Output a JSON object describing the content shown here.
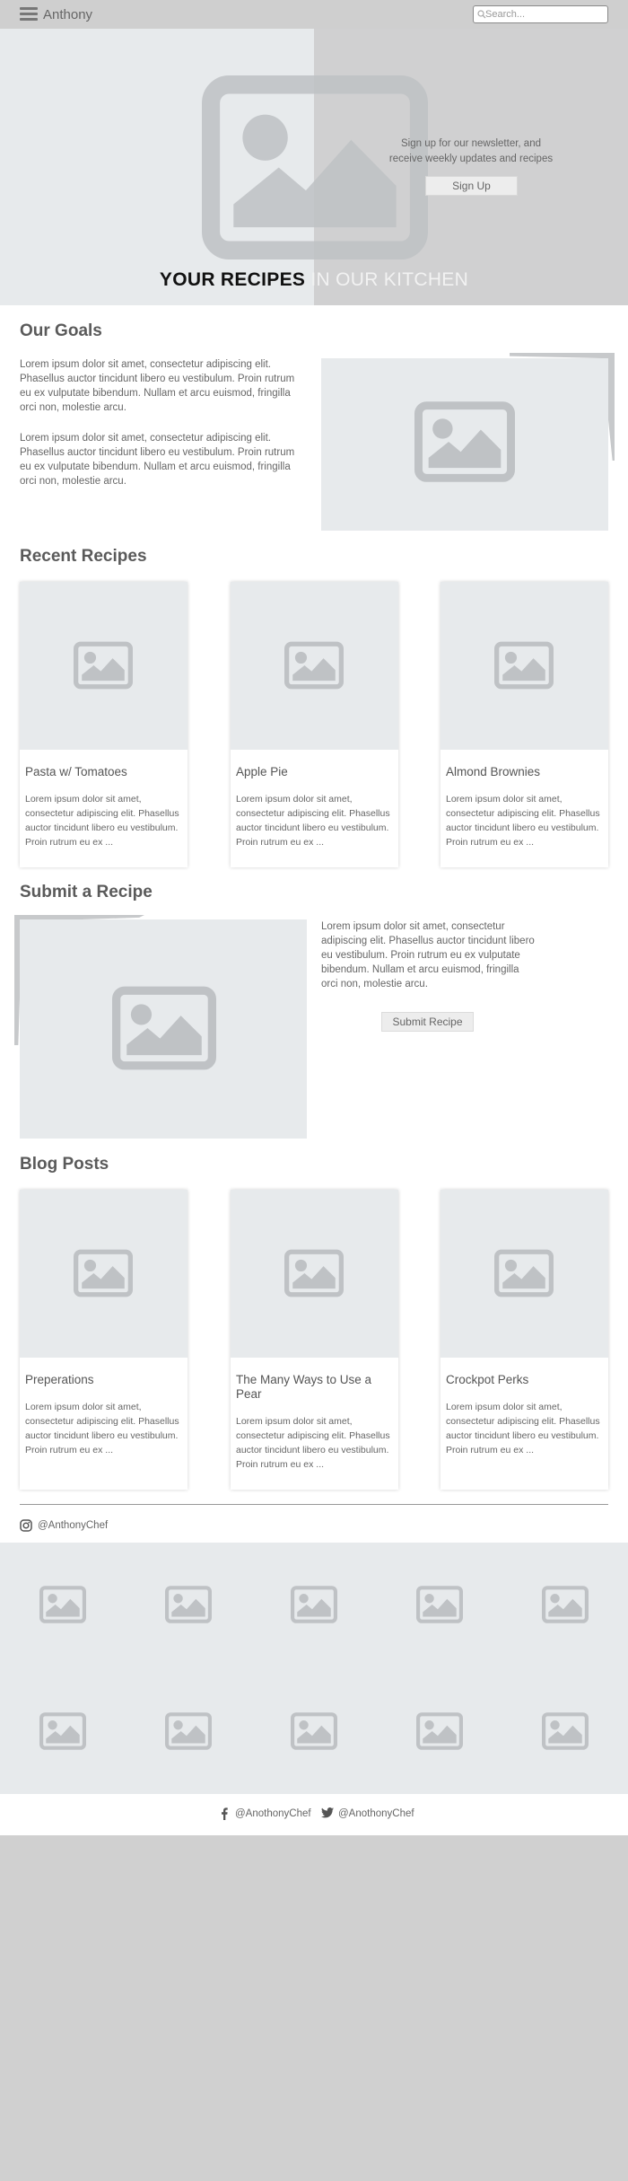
{
  "header": {
    "brand": "Anthony",
    "search_placeholder": "Search...",
    "icons": [
      "hamburger-menu-icon",
      "search-icon"
    ]
  },
  "hero": {
    "newsletter_text": "Sign up for our newsletter, and receive weekly updates and recipes",
    "signup_label": "Sign Up",
    "title_part1": "YOUR RECIPES",
    "title_part2": "IN OUR KITCHEN"
  },
  "goals": {
    "heading": "Our Goals",
    "paragraph1": "Lorem ipsum dolor sit amet, consectetur adipiscing elit. Phasellus auctor tincidunt libero eu vestibulum. Proin rutrum eu ex vulputate bibendum. Nullam et arcu euismod, fringilla orci non, molestie arcu.",
    "paragraph2": "Lorem ipsum dolor sit amet, consectetur adipiscing elit. Phasellus auctor tincidunt libero eu vestibulum. Proin rutrum eu ex vulputate bibendum. Nullam et arcu euismod, fringilla orci non, molestie arcu."
  },
  "recent": {
    "heading": "Recent Recipes",
    "cards": [
      {
        "title": "Pasta w/ Tomatoes",
        "text": "Lorem ipsum dolor sit amet, consectetur adipiscing elit. Phasellus auctor tincidunt libero eu vestibulum. Proin rutrum eu ex ..."
      },
      {
        "title": "Apple Pie",
        "text": "Lorem ipsum dolor sit amet, consectetur adipiscing elit. Phasellus auctor tincidunt libero eu vestibulum. Proin rutrum eu ex ..."
      },
      {
        "title": "Almond Brownies",
        "text": "Lorem ipsum dolor sit amet, consectetur adipiscing elit. Phasellus auctor tincidunt libero eu vestibulum. Proin rutrum eu ex ..."
      }
    ]
  },
  "submit": {
    "heading": "Submit a Recipe",
    "text": "Lorem ipsum dolor sit amet, consectetur adipiscing elit. Phasellus auctor tincidunt libero eu vestibulum. Proin rutrum eu ex vulputate bibendum. Nullam et arcu euismod, fringilla orci non, molestie arcu.",
    "button_label": "Submit Recipe"
  },
  "blog": {
    "heading": "Blog Posts",
    "cards": [
      {
        "title": "Preperations",
        "text": "Lorem ipsum dolor sit amet, consectetur adipiscing elit. Phasellus auctor tincidunt libero eu vestibulum. Proin rutrum eu ex ..."
      },
      {
        "title": "The Many Ways to Use a Pear",
        "text": "Lorem ipsum dolor sit amet, consectetur adipiscing elit. Phasellus auctor tincidunt libero eu vestibulum. Proin rutrum eu ex ..."
      },
      {
        "title": "Crockpot Perks",
        "text": "Lorem ipsum dolor sit amet, consectetur adipiscing elit. Phasellus auctor tincidunt libero eu vestibulum. Proin rutrum eu ex ..."
      }
    ]
  },
  "instagram": {
    "handle": "@AnthonyChef",
    "icon": "instagram-icon"
  },
  "footer": {
    "facebook": "@AnothonyChef",
    "twitter": "@AnothonyChef",
    "icons": [
      "facebook-icon",
      "twitter-icon"
    ]
  },
  "colors": {
    "placeholder_bg": "#e7eaec",
    "placeholder_icon": "#bfc2c5",
    "header_bg": "#cfcfcf",
    "button_bg": "#ededed"
  }
}
